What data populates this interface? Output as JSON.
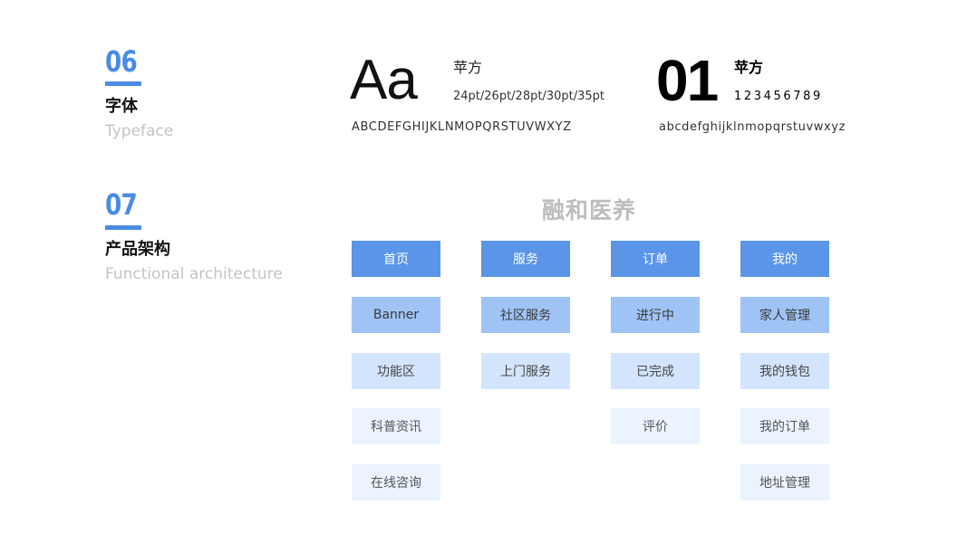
{
  "typeface_section": {
    "number": "06",
    "title": "字体",
    "subtitle": "Typeface",
    "sample_glyphs": "Aa",
    "font_name": "苹方",
    "sizes": "24pt/26pt/28pt/30pt/35pt",
    "uppercase": "ABCDEFGHIJKLNMOPQRSTUVWXYZ",
    "number_sample": "01",
    "font_name_bold": "苹方",
    "digits": "123456789",
    "lowercase": "abcdefghijklnmopqrstuvwxyz"
  },
  "architecture_section": {
    "number": "07",
    "title": "产品架构",
    "subtitle": "Functional architecture",
    "brand": "融和医养",
    "columns": [
      {
        "header": "首页",
        "items": [
          "Banner",
          "功能区",
          "科普资讯",
          "在线咨询"
        ]
      },
      {
        "header": "服务",
        "items": [
          "社区服务",
          "上门服务"
        ]
      },
      {
        "header": "订单",
        "items": [
          "进行中",
          "已完成",
          "评价"
        ]
      },
      {
        "header": "我的",
        "items": [
          "家人管理",
          "我的钱包",
          "我的订单",
          "地址管理"
        ]
      }
    ]
  },
  "colors": {
    "accent": "#4a8be5",
    "level1": "#5b95e8",
    "level2": "#9fc3f5",
    "level3": "#d3e5fc",
    "level4": "#eaf3fe"
  }
}
